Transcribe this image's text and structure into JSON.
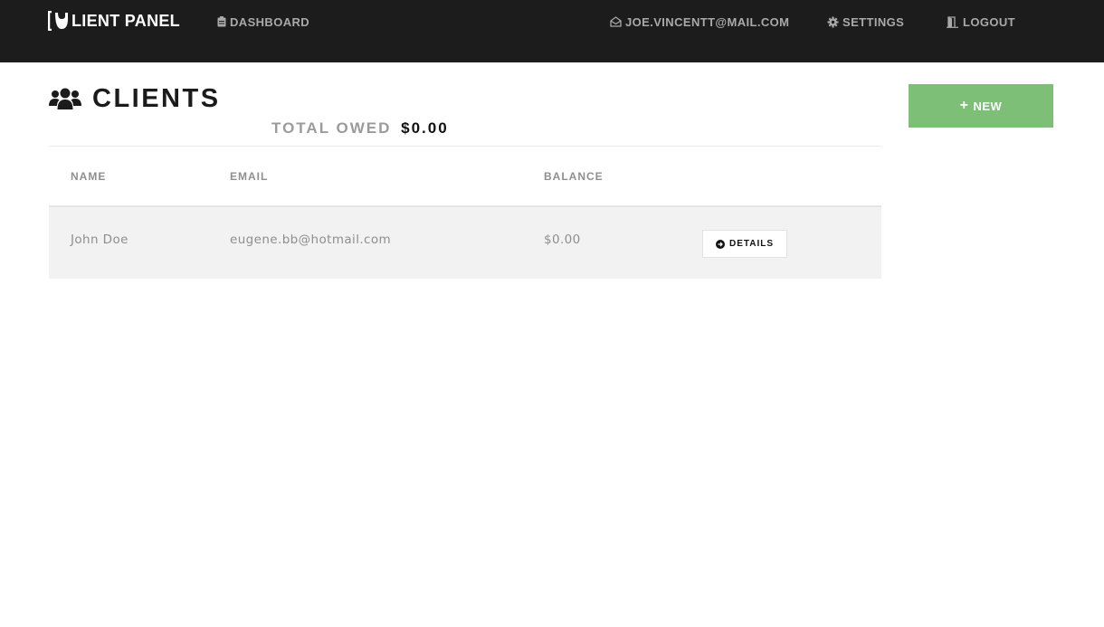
{
  "navbar": {
    "brand": "LIENT PANEL",
    "dashboard": "DASHBOARD",
    "user_email": "JOE.VINCENTT@MAIL.COM",
    "settings": "SETTINGS",
    "logout": "LOGOUT",
    "icons": {
      "brand": "bracket-logo-icon",
      "dashboard": "clipboard-icon",
      "email": "envelope-open-icon",
      "settings": "gear-icon",
      "logout": "door-icon"
    }
  },
  "page": {
    "title": "CLIENTS",
    "title_icon": "users-icon",
    "total_owed_label": "TOTAL OWED",
    "total_owed_value": "$0.00"
  },
  "new_button": {
    "label": "NEW",
    "icon": "plus-icon",
    "color": "#7dbf77"
  },
  "table": {
    "headers": [
      "NAME",
      "EMAIL",
      "BALANCE"
    ],
    "rows": [
      {
        "name": "John Doe",
        "email": "eugene.bb@hotmail.com",
        "balance": "$0.00",
        "action_label": "DETAILS",
        "action_icon": "arrow-circle-right-icon"
      }
    ]
  },
  "colors": {
    "navbar_bg": "#1c1c1c",
    "nav_text": "#a9a9a9",
    "row_bg": "#f2f2f2"
  }
}
